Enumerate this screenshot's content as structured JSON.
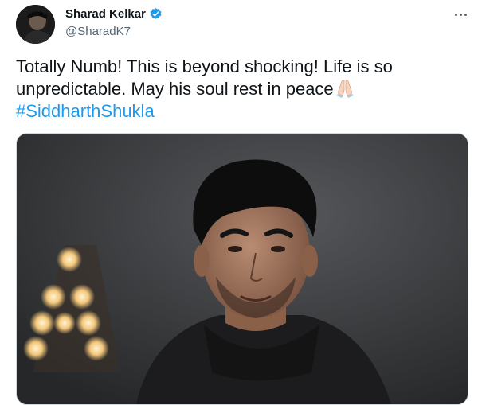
{
  "author": {
    "display_name": "Sharad Kelkar",
    "handle": "@SharadK7",
    "verified": true,
    "avatar_icon": "profile-photo"
  },
  "tweet": {
    "text": "Totally Numb! This is beyond shocking! Life is so unpredictable. May his soul rest in peace",
    "emoji_icon": "folded-hands-icon",
    "hashtag": "#SiddharthShukla"
  },
  "menu": {
    "icon": "more-options-icon"
  },
  "media": {
    "description_icon": "photo-portrait-icon"
  },
  "colors": {
    "link": "#1d9bf0",
    "verified": "#1d9bf0",
    "secondary_text": "#536471"
  }
}
